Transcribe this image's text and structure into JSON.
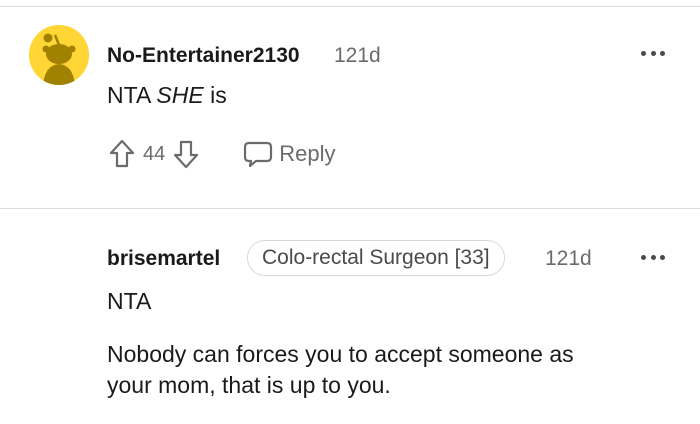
{
  "comments": [
    {
      "username": "No-Entertainer2130",
      "age": "121d",
      "body_prefix": "NTA ",
      "body_emphasis": "SHE",
      "body_suffix": " is",
      "score": "44",
      "reply_label": "Reply"
    },
    {
      "username": "brisemartel",
      "flair": "Colo-rectal Surgeon [33]",
      "age": "121d",
      "paragraph1": "NTA",
      "paragraph2_line1": "Nobody can forces you to accept someone as",
      "paragraph2_line2": "your mom, that is up to you."
    }
  ],
  "colors": {
    "avatar_bg": "#ffd635",
    "avatar_figure": "#a08100",
    "meta_text": "#6b6b6b",
    "divider": "#dcdcdc"
  },
  "icons": [
    "reddit-snoo-avatar-icon",
    "more-options-icon",
    "upvote-arrow-icon",
    "downvote-arrow-icon",
    "chat-bubble-icon"
  ]
}
